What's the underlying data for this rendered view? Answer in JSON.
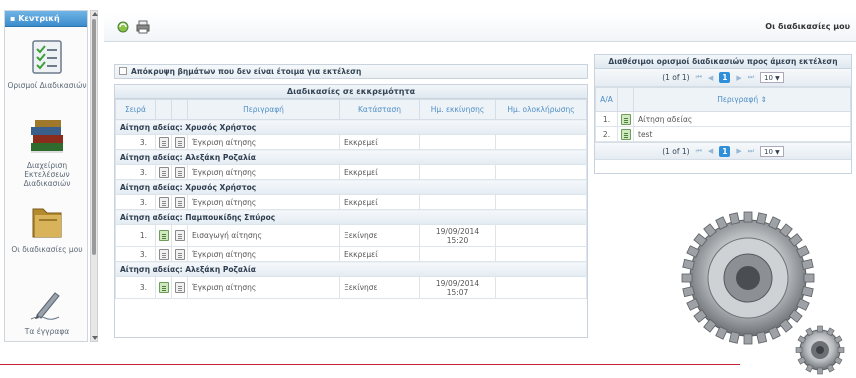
{
  "sidebar": {
    "header": "▪ Κεντρική",
    "items": [
      {
        "label": "Ορισμοί Διαδικασιών",
        "icon": "checklist-icon"
      },
      {
        "label": "Διαχείριση Εκτελέσεων Διαδικασιών",
        "icon": "books-icon"
      },
      {
        "label": "Οι διαδικασίες μου",
        "icon": "folder-icon"
      },
      {
        "label": "Τα έγγραφα",
        "icon": "pen-icon"
      }
    ]
  },
  "toolbar": {
    "page_title": "Οι διαδικασίες μου",
    "icons": [
      "refresh-icon",
      "print-icon"
    ]
  },
  "pending": {
    "filter_label": "Απόκρυψη βημάτων που δεν είναι έτοιμα για εκτέλεση",
    "title": "Διαδικασίες σε εκκρεμότητα",
    "columns": [
      "Σειρά",
      "",
      "",
      "Περιγραφή",
      "Κατάσταση",
      "Ημ. εκκίνησης",
      "Ημ. ολοκλήρωσης"
    ],
    "groups": [
      {
        "title": "Αίτηση αδείας: Χρυσός Χρήστος",
        "rows": [
          {
            "seq": "3.",
            "desc": "Έγκριση αίτησης",
            "status": "Εκκρεμεί",
            "start": "",
            "end": "",
            "green": false
          }
        ]
      },
      {
        "title": "Αίτηση αδείας: Αλεξάκη Ροζαλία",
        "rows": [
          {
            "seq": "3.",
            "desc": "Έγκριση αίτησης",
            "status": "Εκκρεμεί",
            "start": "",
            "end": "",
            "green": false
          }
        ]
      },
      {
        "title": "Αίτηση αδείας: Χρυσός Χρήστος",
        "rows": [
          {
            "seq": "3.",
            "desc": "Έγκριση αίτησης",
            "status": "Εκκρεμεί",
            "start": "",
            "end": "",
            "green": false
          }
        ]
      },
      {
        "title": "Αίτηση αδείας: Παμπουκίδης Σπύρος",
        "rows": [
          {
            "seq": "1.",
            "desc": "Εισαγωγή αίτησης",
            "status": "Ξεκίνησε",
            "start": "19/09/2014 15:20",
            "end": "",
            "green": true
          },
          {
            "seq": "3.",
            "desc": "Έγκριση αίτησης",
            "status": "Εκκρεμεί",
            "start": "",
            "end": "",
            "green": false
          }
        ]
      },
      {
        "title": "Αίτηση αδείας: Αλεξάκη Ροζαλία",
        "rows": [
          {
            "seq": "3.",
            "desc": "Έγκριση αίτησης",
            "status": "Ξεκίνησε",
            "start": "19/09/2014 15:07",
            "end": "",
            "green": true
          }
        ]
      }
    ]
  },
  "available": {
    "title": "Διαθέσιμοι ορισμοί διαδικασιών προς άμεση εκτέλεση",
    "pager": {
      "info": "(1 of 1)",
      "page": "1",
      "per_page": "10"
    },
    "columns": [
      "Α/Α",
      "",
      "Περιγραφή ⇕"
    ],
    "rows": [
      {
        "seq": "1.",
        "desc": "Αίτηση αδείας"
      },
      {
        "seq": "2.",
        "desc": "test"
      }
    ]
  },
  "colors": {
    "accent": "#2f8fd8",
    "header_text": "#4f8ec4",
    "divider": "#c6203a"
  }
}
